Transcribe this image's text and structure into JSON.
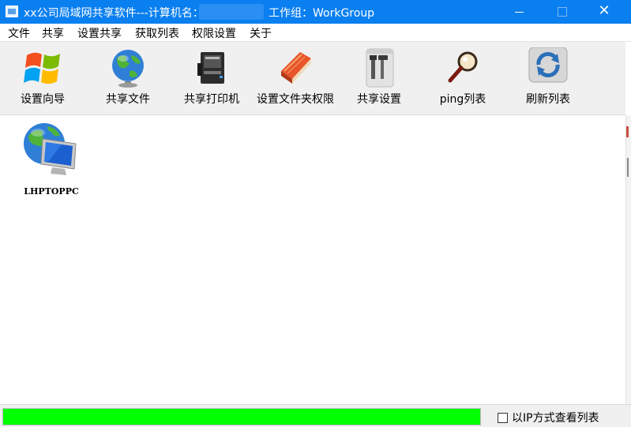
{
  "window": {
    "title": "xx公司局域网共享软件---计算机名：",
    "workgroup": "工作组：WorkGroup",
    "min_glyph": "—",
    "close_glyph": "✕"
  },
  "menu": [
    "文件",
    "共享",
    "设置共享",
    "获取列表",
    "权限设置",
    "关于"
  ],
  "toolbar": [
    {
      "label": "设置向导",
      "icon": "windows-logo-icon"
    },
    {
      "label": "共享文件",
      "icon": "globe-icon"
    },
    {
      "label": "共享打印机",
      "icon": "printer-icon"
    },
    {
      "label": "设置文件夹权限",
      "icon": "folder-book-icon"
    },
    {
      "label": "共享设置",
      "icon": "tools-icon"
    },
    {
      "label": "ping列表",
      "icon": "magnifier-icon"
    },
    {
      "label": "刷新列表",
      "icon": "refresh-icon"
    }
  ],
  "computers": [
    {
      "name": "LHPTOPPC",
      "icon": "network-computer-icon"
    }
  ],
  "status": {
    "progress": 1.0,
    "checkbox_label": "以IP方式查看列表",
    "checkbox_checked": false
  },
  "colors": {
    "titlebar": "#0a7ff0",
    "progress_fill": "#00ff00",
    "toolbar_bg": "#f0f0f0"
  }
}
